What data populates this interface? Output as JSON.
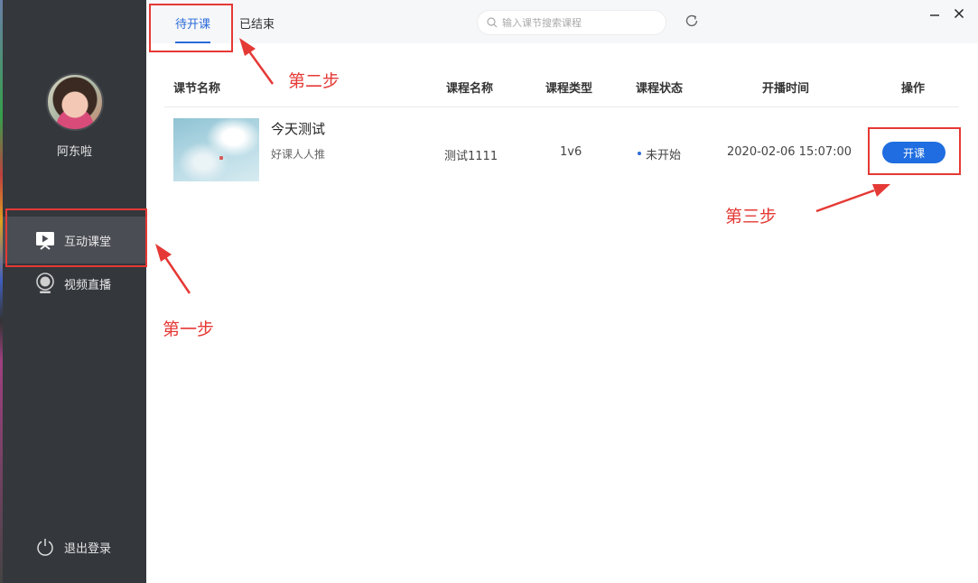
{
  "sidebar": {
    "username": "阿东啦",
    "nav": [
      {
        "label": "互动课堂",
        "icon": "classroom-play-icon",
        "active": true
      },
      {
        "label": "视频直播",
        "icon": "webcam-icon",
        "active": false
      }
    ],
    "logout_label": "退出登录"
  },
  "tabs": [
    {
      "label": "待开课",
      "active": true
    },
    {
      "label": "已结束",
      "active": false
    }
  ],
  "search": {
    "placeholder": "输入课节搜索课程",
    "value": ""
  },
  "table": {
    "headers": [
      "课节名称",
      "课程名称",
      "课程类型",
      "课程状态",
      "开播时间",
      "操作"
    ],
    "rows": [
      {
        "lesson_title": "今天测试",
        "lesson_subtitle": "好课人人推",
        "course_name": "测试1111",
        "course_type": "1v6",
        "status": "未开始",
        "start_time": "2020-02-06 15:07:00",
        "action_label": "开课"
      }
    ]
  },
  "annotations": {
    "step1": "第一步",
    "step2": "第二步",
    "step3": "第三步"
  },
  "colors": {
    "accent": "#1f6de0",
    "sidebar": "#34373c",
    "annotation": "#e53935"
  }
}
